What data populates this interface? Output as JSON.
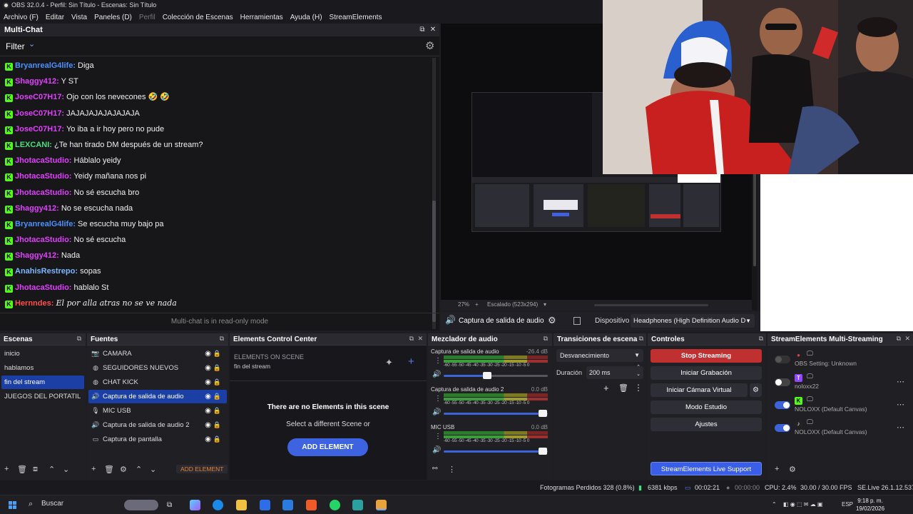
{
  "window": {
    "title": "OBS 32.0.4 - Perfil: Sin Título - Escenas: Sin Título"
  },
  "menu": [
    "Archivo (F)",
    "Editar",
    "Vista",
    "Paneles (D)",
    "Perfil",
    "Colección de Escenas",
    "Herramientas",
    "Ayuda (H)",
    "StreamElements"
  ],
  "chat": {
    "title": "Multi-Chat",
    "filter": "Filter",
    "readonly": "Multi-chat is in read-only mode",
    "badge": "K",
    "messages": [
      {
        "user": "BryanrealG4life:",
        "text": "Diga",
        "color": "#4a90ff"
      },
      {
        "user": "Shaggy412:",
        "text": "Y ST",
        "color": "#e040fb"
      },
      {
        "user": "JoseC07H17:",
        "text": "Ojo con los nevecones 🤣 🤣",
        "color": "#e040fb"
      },
      {
        "user": "JoseC07H17:",
        "text": "JAJAJAJAJAJAJAJA",
        "color": "#e040fb"
      },
      {
        "user": "JoseC07H17:",
        "text": "Yo iba a ir hoy pero no pude",
        "color": "#e040fb"
      },
      {
        "user": "LEXCANI:",
        "text": "¿Te han tirado DM después de un stream?",
        "color": "#4ade80"
      },
      {
        "user": "JhotacaStudio:",
        "text": "Háblalo yeidy",
        "color": "#e040fb"
      },
      {
        "user": "JhotacaStudio:",
        "text": "Yeidy mañana nos pi",
        "color": "#e040fb"
      },
      {
        "user": "JhotacaStudio:",
        "text": "No sé escucha bro",
        "color": "#e040fb"
      },
      {
        "user": "Shaggy412:",
        "text": "No se escucha nada",
        "color": "#e040fb"
      },
      {
        "user": "BryanrealG4life:",
        "text": "Se escucha muy bajo pa",
        "color": "#4a90ff"
      },
      {
        "user": "JhotacaStudio:",
        "text": "No sé escucha",
        "color": "#e040fb"
      },
      {
        "user": "Shaggy412:",
        "text": "Nada",
        "color": "#e040fb"
      },
      {
        "user": "AnahisRestrepo:",
        "text": "sopas",
        "color": "#7ab8ff"
      },
      {
        "user": "JhotacaStudio:",
        "text": "hablalo St",
        "color": "#e040fb"
      },
      {
        "user": "Hernndes:",
        "text": "El por alla atras no se ve nada",
        "color": "#ff4d4d",
        "italic": true
      }
    ]
  },
  "preview": {
    "zoom": "27%",
    "plus": "+",
    "scale": "Escalado (523x294)"
  },
  "audio_bar": {
    "source": "Captura de salida de audio",
    "device_label": "Dispositivo",
    "device": "Headphones (High Definition Audio D"
  },
  "scenes": {
    "title": "Escenas",
    "items": [
      "inicio",
      "hablamos",
      "fin del stream",
      "JUEGOS DEL PORTATIL"
    ],
    "selected": 2
  },
  "sources": {
    "title": "Fuentes",
    "items": [
      {
        "icon": "camera-icon",
        "glyph": "📷",
        "name": "CAMARA"
      },
      {
        "icon": "browser-icon",
        "glyph": "◍",
        "name": "SEGUIDORES NUEVOS"
      },
      {
        "icon": "browser-icon",
        "glyph": "◍",
        "name": "CHAT KICK"
      },
      {
        "icon": "speaker-icon",
        "glyph": "🔊",
        "name": "Captura de salida de audio",
        "selected": true
      },
      {
        "icon": "mic-icon",
        "glyph": "🎙",
        "name": "MIC USB"
      },
      {
        "icon": "speaker-icon",
        "glyph": "🔊",
        "name": "Captura de salida de audio 2"
      },
      {
        "icon": "monitor-icon",
        "glyph": "▭",
        "name": "Captura de pantalla"
      }
    ],
    "add_element": "ADD ELEMENT"
  },
  "ecc": {
    "title": "Elements Control Center",
    "on_scene": "ELEMENTS ON SCENE",
    "scene": "fin del stream",
    "empty": "There are no Elements in this scene",
    "hint": "Select a different Scene or",
    "add": "ADD ELEMENT"
  },
  "mixer": {
    "title": "Mezclador de audio",
    "scale": "-60 -55 -50 -45 -40 -35 -30 -25 -20 -15 -10 -5 0",
    "channels": [
      {
        "name": "Captura de salida de audio",
        "db": "-26.4 dB",
        "level": 0.42
      },
      {
        "name": "Captura de salida de audio 2",
        "db": "0.0 dB",
        "level": 0.95
      },
      {
        "name": "MIC USB",
        "db": "0.0 dB",
        "level": 0.95
      }
    ]
  },
  "transitions": {
    "title": "Transiciones de escena",
    "selected": "Desvanecimiento",
    "duration_label": "Duración",
    "duration": "200 ms"
  },
  "controls": {
    "title": "Controles",
    "buttons": [
      "Stop Streaming",
      "Iniciar Grabación",
      "Iniciar Cámara Virtual",
      "Modo Estudio",
      "Ajustes"
    ],
    "support": "StreamElements Live Support"
  },
  "multistream": {
    "title": "StreamElements Multi-Streaming",
    "rows": [
      {
        "name": "OBS Setting: Unknown",
        "state": "disabled"
      },
      {
        "name": "noloxx22",
        "state": "off",
        "platform": "twitch",
        "color": "#9146ff",
        "glyph": "T"
      },
      {
        "name": "NOLOXX (Default Canvas)",
        "state": "on",
        "platform": "kick",
        "color": "#53fc18",
        "glyph": "K"
      },
      {
        "name": "NOLOXX (Default Canvas)",
        "state": "on",
        "platform": "tiktok",
        "color": "#ffffff",
        "glyph": "♪"
      }
    ]
  },
  "status": {
    "dropped": "Fotogramas Perdidos 328 (0.8%)",
    "kbps": "6381 kbps",
    "stream_time": "00:02:21",
    "rec_time": "00:00:00",
    "cpu": "CPU: 2.4%",
    "fps": "30.00 / 30.00 FPS",
    "version": "SE.Live 26.1.12.537"
  },
  "taskbar": {
    "search": "Buscar",
    "lang": "ESP",
    "time": "9:18 p. m.",
    "date": "19/02/2026"
  }
}
